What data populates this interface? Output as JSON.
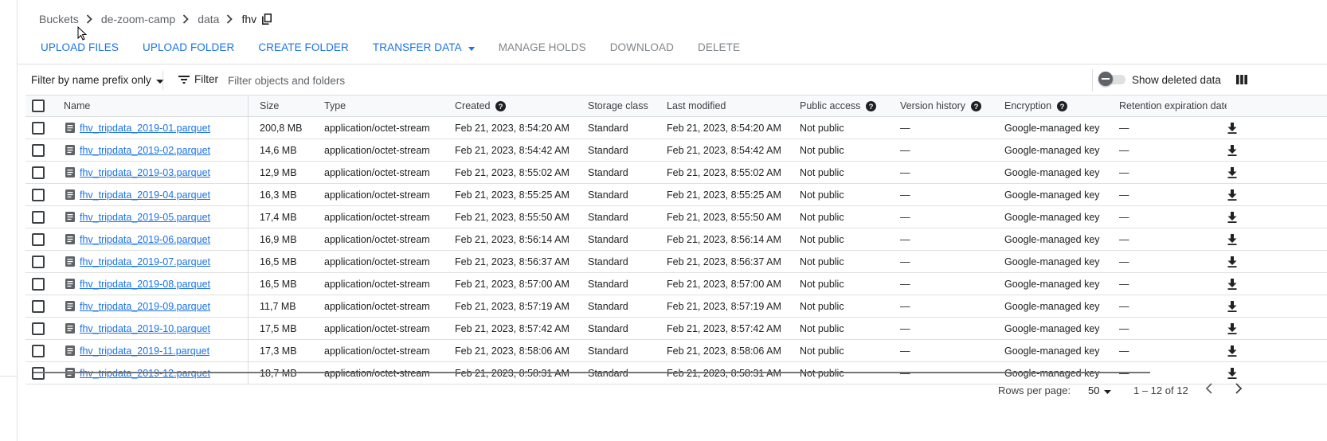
{
  "breadcrumb": {
    "root": "Buckets",
    "bucket": "de-zoom-camp",
    "folder": "data",
    "current": "fhv"
  },
  "toolbar": {
    "upload_files": "UPLOAD FILES",
    "upload_folder": "UPLOAD FOLDER",
    "create_folder": "CREATE FOLDER",
    "transfer_data": "TRANSFER DATA",
    "manage_holds": "MANAGE HOLDS",
    "download": "DOWNLOAD",
    "delete": "DELETE"
  },
  "filterbar": {
    "prefix_mode": "Filter by name prefix only",
    "filter_label": "Filter",
    "filter_placeholder": "Filter objects and folders",
    "show_deleted_label": "Show deleted data",
    "show_deleted_on": false
  },
  "columns": {
    "name": "Name",
    "size": "Size",
    "type": "Type",
    "created": "Created",
    "storage_class": "Storage class",
    "last_modified": "Last modified",
    "public_access": "Public access",
    "version_history": "Version history",
    "encryption": "Encryption",
    "retention": "Retention expiration date"
  },
  "rows": [
    {
      "name": "fhv_tripdata_2019-01.parquet",
      "size": "200,8 MB",
      "type": "application/octet-stream",
      "created": "Feb 21, 2023, 8:54:20 AM",
      "storage_class": "Standard",
      "last_modified": "Feb 21, 2023, 8:54:20 AM",
      "public_access": "Not public",
      "version_history": "—",
      "encryption": "Google-managed key",
      "retention": "—"
    },
    {
      "name": "fhv_tripdata_2019-02.parquet",
      "size": "14,6 MB",
      "type": "application/octet-stream",
      "created": "Feb 21, 2023, 8:54:42 AM",
      "storage_class": "Standard",
      "last_modified": "Feb 21, 2023, 8:54:42 AM",
      "public_access": "Not public",
      "version_history": "—",
      "encryption": "Google-managed key",
      "retention": "—"
    },
    {
      "name": "fhv_tripdata_2019-03.parquet",
      "size": "12,9 MB",
      "type": "application/octet-stream",
      "created": "Feb 21, 2023, 8:55:02 AM",
      "storage_class": "Standard",
      "last_modified": "Feb 21, 2023, 8:55:02 AM",
      "public_access": "Not public",
      "version_history": "—",
      "encryption": "Google-managed key",
      "retention": "—"
    },
    {
      "name": "fhv_tripdata_2019-04.parquet",
      "size": "16,3 MB",
      "type": "application/octet-stream",
      "created": "Feb 21, 2023, 8:55:25 AM",
      "storage_class": "Standard",
      "last_modified": "Feb 21, 2023, 8:55:25 AM",
      "public_access": "Not public",
      "version_history": "—",
      "encryption": "Google-managed key",
      "retention": "—"
    },
    {
      "name": "fhv_tripdata_2019-05.parquet",
      "size": "17,4 MB",
      "type": "application/octet-stream",
      "created": "Feb 21, 2023, 8:55:50 AM",
      "storage_class": "Standard",
      "last_modified": "Feb 21, 2023, 8:55:50 AM",
      "public_access": "Not public",
      "version_history": "—",
      "encryption": "Google-managed key",
      "retention": "—"
    },
    {
      "name": "fhv_tripdata_2019-06.parquet",
      "size": "16,9 MB",
      "type": "application/octet-stream",
      "created": "Feb 21, 2023, 8:56:14 AM",
      "storage_class": "Standard",
      "last_modified": "Feb 21, 2023, 8:56:14 AM",
      "public_access": "Not public",
      "version_history": "—",
      "encryption": "Google-managed key",
      "retention": "—"
    },
    {
      "name": "fhv_tripdata_2019-07.parquet",
      "size": "16,5 MB",
      "type": "application/octet-stream",
      "created": "Feb 21, 2023, 8:56:37 AM",
      "storage_class": "Standard",
      "last_modified": "Feb 21, 2023, 8:56:37 AM",
      "public_access": "Not public",
      "version_history": "—",
      "encryption": "Google-managed key",
      "retention": "—"
    },
    {
      "name": "fhv_tripdata_2019-08.parquet",
      "size": "16,5 MB",
      "type": "application/octet-stream",
      "created": "Feb 21, 2023, 8:57:00 AM",
      "storage_class": "Standard",
      "last_modified": "Feb 21, 2023, 8:57:00 AM",
      "public_access": "Not public",
      "version_history": "—",
      "encryption": "Google-managed key",
      "retention": "—"
    },
    {
      "name": "fhv_tripdata_2019-09.parquet",
      "size": "11,7 MB",
      "type": "application/octet-stream",
      "created": "Feb 21, 2023, 8:57:19 AM",
      "storage_class": "Standard",
      "last_modified": "Feb 21, 2023, 8:57:19 AM",
      "public_access": "Not public",
      "version_history": "—",
      "encryption": "Google-managed key",
      "retention": "—"
    },
    {
      "name": "fhv_tripdata_2019-10.parquet",
      "size": "17,5 MB",
      "type": "application/octet-stream",
      "created": "Feb 21, 2023, 8:57:42 AM",
      "storage_class": "Standard",
      "last_modified": "Feb 21, 2023, 8:57:42 AM",
      "public_access": "Not public",
      "version_history": "—",
      "encryption": "Google-managed key",
      "retention": "—"
    },
    {
      "name": "fhv_tripdata_2019-11.parquet",
      "size": "17,3 MB",
      "type": "application/octet-stream",
      "created": "Feb 21, 2023, 8:58:06 AM",
      "storage_class": "Standard",
      "last_modified": "Feb 21, 2023, 8:58:06 AM",
      "public_access": "Not public",
      "version_history": "—",
      "encryption": "Google-managed key",
      "retention": "—"
    },
    {
      "name": "fhv_tripdata_2019-12.parquet",
      "size": "18,7 MB",
      "type": "application/octet-stream",
      "created": "Feb 21, 2023, 8:58:31 AM",
      "storage_class": "Standard",
      "last_modified": "Feb 21, 2023, 8:58:31 AM",
      "public_access": "Not public",
      "version_history": "—",
      "encryption": "Google-managed key",
      "retention": "—"
    }
  ],
  "pagination": {
    "rows_per_page_label": "Rows per page:",
    "rows_per_page": "50",
    "range": "1 – 12 of 12"
  },
  "icons": {
    "breadcrumb_separator": "chevron-right-icon",
    "copy": "copy-icon",
    "filter": "filter-list-icon",
    "help": "help-icon",
    "file": "file-icon",
    "download": "download-icon",
    "columns": "view-columns-icon",
    "prev": "chevron-left-icon",
    "next": "chevron-right-icon"
  },
  "colors": {
    "accent": "#1a73e8",
    "text": "#202124",
    "muted": "#5f6368",
    "divider": "#e0e0e0"
  }
}
